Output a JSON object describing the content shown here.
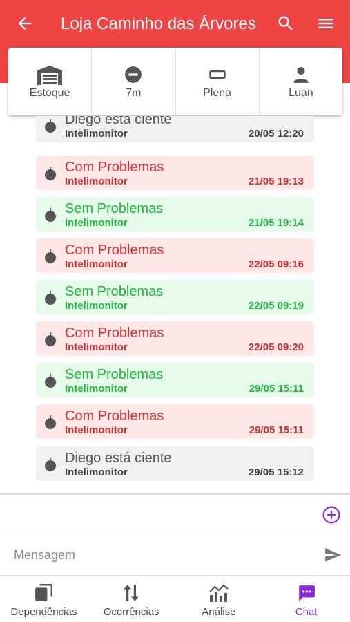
{
  "header": {
    "title": "Loja Caminho das Árvores",
    "background_color": "#ee4444"
  },
  "status": {
    "items": [
      {
        "label": "Estoque",
        "icon": "warehouse-icon"
      },
      {
        "label": "7m",
        "icon": "minus-circle-icon"
      },
      {
        "label": "Plena",
        "icon": "battery-full-icon"
      },
      {
        "label": "Luan",
        "icon": "person-icon"
      }
    ]
  },
  "messages": [
    {
      "text": "Diego está ciente",
      "author": "Intelimonitor",
      "time": "20/05 12:20",
      "state": "neutral"
    },
    {
      "text": "Com Problemas",
      "author": "Intelimonitor",
      "time": "21/05 19:13",
      "state": "problem"
    },
    {
      "text": "Sem Problemas",
      "author": "Intelimonitor",
      "time": "21/05 19:14",
      "state": "ok"
    },
    {
      "text": "Com Problemas",
      "author": "Intelimonitor",
      "time": "22/05 09:16",
      "state": "problem"
    },
    {
      "text": "Sem Problemas",
      "author": "Intelimonitor",
      "time": "22/05 09:19",
      "state": "ok"
    },
    {
      "text": "Com Problemas",
      "author": "Intelimonitor",
      "time": "22/05 09:20",
      "state": "problem"
    },
    {
      "text": "Sem Problemas",
      "author": "Intelimonitor",
      "time": "29/05 15:11",
      "state": "ok"
    },
    {
      "text": "Com Problemas",
      "author": "Intelimonitor",
      "time": "29/05 15:11",
      "state": "problem"
    },
    {
      "text": "Diego está ciente",
      "author": "Intelimonitor",
      "time": "29/05 15:12",
      "state": "neutral"
    }
  ],
  "composer": {
    "placeholder": "Mensagem",
    "value": ""
  },
  "nav": {
    "tabs": [
      {
        "label": "Dependências",
        "icon": "cards-icon"
      },
      {
        "label": "Ocorrências",
        "icon": "sort-arrows-icon"
      },
      {
        "label": "Análise",
        "icon": "chart-icon"
      },
      {
        "label": "Chat",
        "icon": "chat-icon",
        "active": true
      }
    ]
  },
  "colors": {
    "accent": "#8a2be2",
    "problem": "#d32f2f",
    "ok": "#1db83c",
    "neutral": "#555555"
  }
}
